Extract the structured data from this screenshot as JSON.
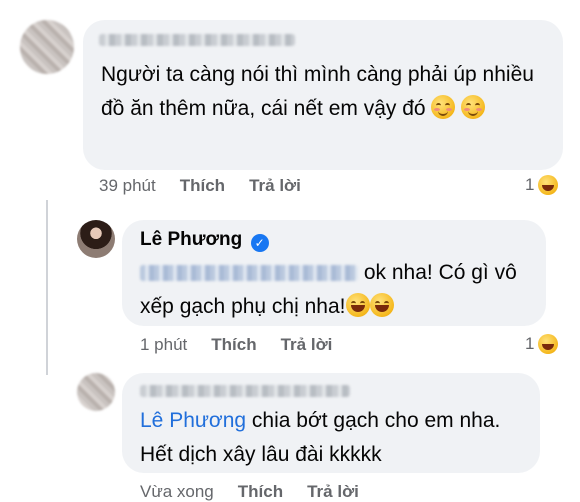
{
  "comments": [
    {
      "text": "Người ta càng nói thì mình càng phải úp nhiều đồ ăn thêm nữa, cái nết em vậy đó",
      "time": "39 phút",
      "like_label": "Thích",
      "reply_label": "Trả lời",
      "reaction_count": "1",
      "reaction_icon": "laughing-emoji-icon",
      "emojis": [
        "smiling-face-icon",
        "smiling-face-icon"
      ]
    },
    {
      "author": "Lê Phương",
      "verified": true,
      "text_part1": "ok nha! Có gì vô",
      "text_part2": "xếp gạch phụ chị nha!",
      "time": "1 phút",
      "like_label": "Thích",
      "reply_label": "Trả lời",
      "reaction_count": "1",
      "reaction_icon": "laughing-emoji-icon",
      "emojis": [
        "sweat-smile-icon",
        "laughing-emoji-icon"
      ]
    },
    {
      "mention": "Lê Phương",
      "text_part1": "chia bớt gạch cho em nha.",
      "text_part2": "Hết dịch xây lâu đài kkkkk",
      "time": "Vừa xong",
      "like_label": "Thích",
      "reply_label": "Trả lời"
    }
  ],
  "colors": {
    "bubble": "#f0f2f5",
    "mention": "#216fdb",
    "meta": "#65676b",
    "verified": "#1877f2"
  }
}
